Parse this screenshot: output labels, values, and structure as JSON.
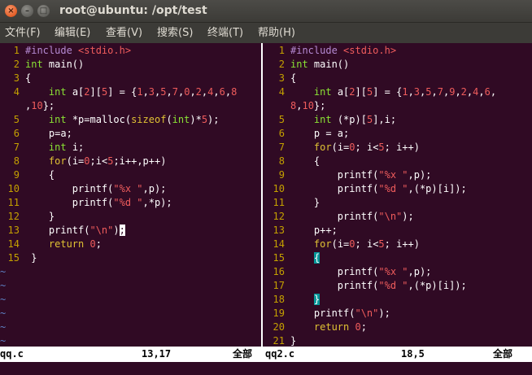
{
  "window": {
    "title": "root@ubuntu: /opt/test",
    "close": "×",
    "min": "–",
    "max": "□"
  },
  "menu": [
    "文件(F)",
    "编辑(E)",
    "查看(V)",
    "搜索(S)",
    "终端(T)",
    "帮助(H)"
  ],
  "left": {
    "lines": [
      {
        "n": "1",
        "segs": [
          {
            "t": "#include ",
            "c": "pre"
          },
          {
            "t": "<stdio.h>",
            "c": "str"
          }
        ]
      },
      {
        "n": "2",
        "segs": [
          {
            "t": "int",
            "c": "type"
          },
          {
            "t": " main()"
          }
        ]
      },
      {
        "n": "3",
        "segs": [
          {
            "t": "{"
          }
        ]
      },
      {
        "n": "4",
        "segs": [
          {
            "t": "    "
          },
          {
            "t": "int",
            "c": "type"
          },
          {
            "t": " a["
          },
          {
            "t": "2",
            "c": "num"
          },
          {
            "t": "]["
          },
          {
            "t": "5",
            "c": "num"
          },
          {
            "t": "] = {"
          },
          {
            "t": "1",
            "c": "num"
          },
          {
            "t": ","
          },
          {
            "t": "3",
            "c": "num"
          },
          {
            "t": ","
          },
          {
            "t": "5",
            "c": "num"
          },
          {
            "t": ","
          },
          {
            "t": "7",
            "c": "num"
          },
          {
            "t": ","
          },
          {
            "t": "0",
            "c": "num"
          },
          {
            "t": ","
          },
          {
            "t": "2",
            "c": "num"
          },
          {
            "t": ","
          },
          {
            "t": "4",
            "c": "num"
          },
          {
            "t": ","
          },
          {
            "t": "6",
            "c": "num"
          },
          {
            "t": ","
          },
          {
            "t": "8",
            "c": "num"
          }
        ]
      },
      {
        "n": "",
        "segs": [
          {
            "t": ","
          },
          {
            "t": "10",
            "c": "num"
          },
          {
            "t": "};"
          }
        ]
      },
      {
        "n": "5",
        "segs": [
          {
            "t": "    "
          },
          {
            "t": "int",
            "c": "type"
          },
          {
            "t": " *p=malloc("
          },
          {
            "t": "sizeof",
            "c": "kw"
          },
          {
            "t": "("
          },
          {
            "t": "int",
            "c": "type"
          },
          {
            "t": ")*"
          },
          {
            "t": "5",
            "c": "num"
          },
          {
            "t": ");"
          }
        ]
      },
      {
        "n": "6",
        "segs": [
          {
            "t": "    p=a;"
          }
        ]
      },
      {
        "n": "7",
        "segs": [
          {
            "t": "    "
          },
          {
            "t": "int",
            "c": "type"
          },
          {
            "t": " i;"
          }
        ]
      },
      {
        "n": "8",
        "segs": [
          {
            "t": "    "
          },
          {
            "t": "for",
            "c": "kw"
          },
          {
            "t": "(i="
          },
          {
            "t": "0",
            "c": "num"
          },
          {
            "t": ";i<"
          },
          {
            "t": "5",
            "c": "num"
          },
          {
            "t": ";i++,p++)"
          }
        ]
      },
      {
        "n": "9",
        "segs": [
          {
            "t": "    {"
          }
        ]
      },
      {
        "n": "10",
        "segs": [
          {
            "t": "        printf("
          },
          {
            "t": "\"%x \"",
            "c": "str"
          },
          {
            "t": ",p);"
          }
        ]
      },
      {
        "n": "11",
        "segs": [
          {
            "t": "        printf("
          },
          {
            "t": "\"%d \"",
            "c": "str"
          },
          {
            "t": ",*p);"
          }
        ]
      },
      {
        "n": "12",
        "segs": [
          {
            "t": "    }"
          }
        ]
      },
      {
        "n": "13",
        "segs": [
          {
            "t": "    printf("
          },
          {
            "t": "\"\\n\"",
            "c": "str"
          },
          {
            "t": ")"
          },
          {
            "t": ";",
            "c": "cur"
          }
        ]
      },
      {
        "n": "14",
        "segs": [
          {
            "t": "    "
          },
          {
            "t": "return",
            "c": "kw"
          },
          {
            "t": " "
          },
          {
            "t": "0",
            "c": "num"
          },
          {
            "t": ";"
          }
        ]
      },
      {
        "n": "15",
        "segs": [
          {
            "t": " }"
          }
        ]
      }
    ],
    "tildes": [
      "~",
      "~",
      "~",
      "~",
      "~",
      "~"
    ],
    "status": {
      "file": "qq.c",
      "pos": "13,17",
      "scroll": "全部"
    }
  },
  "right": {
    "lines": [
      {
        "n": "1",
        "segs": [
          {
            "t": "#include ",
            "c": "pre"
          },
          {
            "t": "<stdio.h>",
            "c": "str"
          }
        ]
      },
      {
        "n": "2",
        "segs": [
          {
            "t": "int",
            "c": "type"
          },
          {
            "t": " main()"
          }
        ]
      },
      {
        "n": "3",
        "segs": [
          {
            "t": "{"
          }
        ]
      },
      {
        "n": "4",
        "segs": [
          {
            "t": "    "
          },
          {
            "t": "int",
            "c": "type"
          },
          {
            "t": " a["
          },
          {
            "t": "2",
            "c": "num"
          },
          {
            "t": "]["
          },
          {
            "t": "5",
            "c": "num"
          },
          {
            "t": "] = {"
          },
          {
            "t": "1",
            "c": "num"
          },
          {
            "t": ","
          },
          {
            "t": "3",
            "c": "num"
          },
          {
            "t": ","
          },
          {
            "t": "5",
            "c": "num"
          },
          {
            "t": ","
          },
          {
            "t": "7",
            "c": "num"
          },
          {
            "t": ","
          },
          {
            "t": "9",
            "c": "num"
          },
          {
            "t": ","
          },
          {
            "t": "2",
            "c": "num"
          },
          {
            "t": ","
          },
          {
            "t": "4",
            "c": "num"
          },
          {
            "t": ","
          },
          {
            "t": "6",
            "c": "num"
          },
          {
            "t": ","
          }
        ]
      },
      {
        "n": "",
        "segs": [
          {
            "t": "8",
            "c": "num"
          },
          {
            "t": ","
          },
          {
            "t": "10",
            "c": "num"
          },
          {
            "t": "};"
          }
        ]
      },
      {
        "n": "5",
        "segs": [
          {
            "t": "    "
          },
          {
            "t": "int",
            "c": "type"
          },
          {
            "t": " (*p)["
          },
          {
            "t": "5",
            "c": "num"
          },
          {
            "t": "],i;"
          }
        ]
      },
      {
        "n": "6",
        "segs": [
          {
            "t": "    p = a;"
          }
        ]
      },
      {
        "n": "7",
        "segs": [
          {
            "t": "    "
          },
          {
            "t": "for",
            "c": "kw"
          },
          {
            "t": "(i="
          },
          {
            "t": "0",
            "c": "num"
          },
          {
            "t": "; i<"
          },
          {
            "t": "5",
            "c": "num"
          },
          {
            "t": "; i++)"
          }
        ]
      },
      {
        "n": "8",
        "segs": [
          {
            "t": "    {"
          }
        ]
      },
      {
        "n": "9",
        "segs": [
          {
            "t": "        printf("
          },
          {
            "t": "\"%x \"",
            "c": "str"
          },
          {
            "t": ",p);"
          }
        ]
      },
      {
        "n": "10",
        "segs": [
          {
            "t": "        printf("
          },
          {
            "t": "\"%d \"",
            "c": "str"
          },
          {
            "t": ",(*p)[i]);"
          }
        ]
      },
      {
        "n": "11",
        "segs": [
          {
            "t": "    }"
          }
        ]
      },
      {
        "n": "12",
        "segs": [
          {
            "t": "        printf("
          },
          {
            "t": "\"\\n\"",
            "c": "str"
          },
          {
            "t": ");"
          }
        ]
      },
      {
        "n": "13",
        "segs": [
          {
            "t": "    p++;"
          }
        ]
      },
      {
        "n": "14",
        "segs": [
          {
            "t": "    "
          },
          {
            "t": "for",
            "c": "kw"
          },
          {
            "t": "(i="
          },
          {
            "t": "0",
            "c": "num"
          },
          {
            "t": "; i<"
          },
          {
            "t": "5",
            "c": "num"
          },
          {
            "t": "; i++)"
          }
        ]
      },
      {
        "n": "15",
        "segs": [
          {
            "t": "    "
          },
          {
            "t": "{",
            "c": "match"
          }
        ]
      },
      {
        "n": "16",
        "segs": [
          {
            "t": "        printf("
          },
          {
            "t": "\"%x \"",
            "c": "str"
          },
          {
            "t": ",p);"
          }
        ]
      },
      {
        "n": "17",
        "segs": [
          {
            "t": "        printf("
          },
          {
            "t": "\"%d \"",
            "c": "str"
          },
          {
            "t": ",(*p)[i]);"
          }
        ]
      },
      {
        "n": "18",
        "segs": [
          {
            "t": "    "
          },
          {
            "t": "}",
            "c": "match"
          }
        ]
      },
      {
        "n": "19",
        "segs": [
          {
            "t": "    printf("
          },
          {
            "t": "\"\\n\"",
            "c": "str"
          },
          {
            "t": ");"
          }
        ]
      },
      {
        "n": "20",
        "segs": [
          {
            "t": "    "
          },
          {
            "t": "return",
            "c": "kw"
          },
          {
            "t": " "
          },
          {
            "t": "0",
            "c": "num"
          },
          {
            "t": ";"
          }
        ]
      },
      {
        "n": "21",
        "segs": [
          {
            "t": "}"
          }
        ]
      }
    ],
    "status": {
      "file": "qq2.c",
      "pos": "18,5",
      "scroll": "全部"
    }
  }
}
